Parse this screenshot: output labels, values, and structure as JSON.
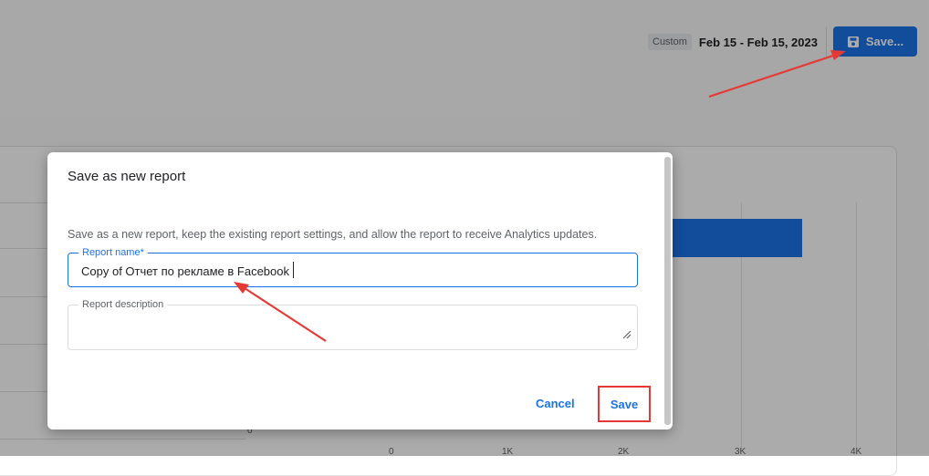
{
  "header": {
    "date_chip": "Custom",
    "date_range": "Feb 15 - Feb 15, 2023",
    "save_label": "Save..."
  },
  "chart_axis": {
    "zero_tick": "0",
    "x_ticks": [
      "0",
      "1K",
      "2K",
      "3K",
      "4K"
    ]
  },
  "dialog": {
    "title": "Save as new report",
    "description": "Save as a new report, keep the existing report settings, and allow the report to receive Analytics updates.",
    "name_field": {
      "label": "Report name*",
      "value": "Copy of Отчет по рекламе в Facebook"
    },
    "description_field": {
      "label": "Report description",
      "value": ""
    },
    "cancel_label": "Cancel",
    "save_label": "Save"
  },
  "colors": {
    "accent": "#1a73e8",
    "highlight_box": "#e53935",
    "arrow": "#e53935"
  },
  "icons": {
    "save_top": "floppy-disk-icon",
    "resize": "resize-handle-icon"
  }
}
